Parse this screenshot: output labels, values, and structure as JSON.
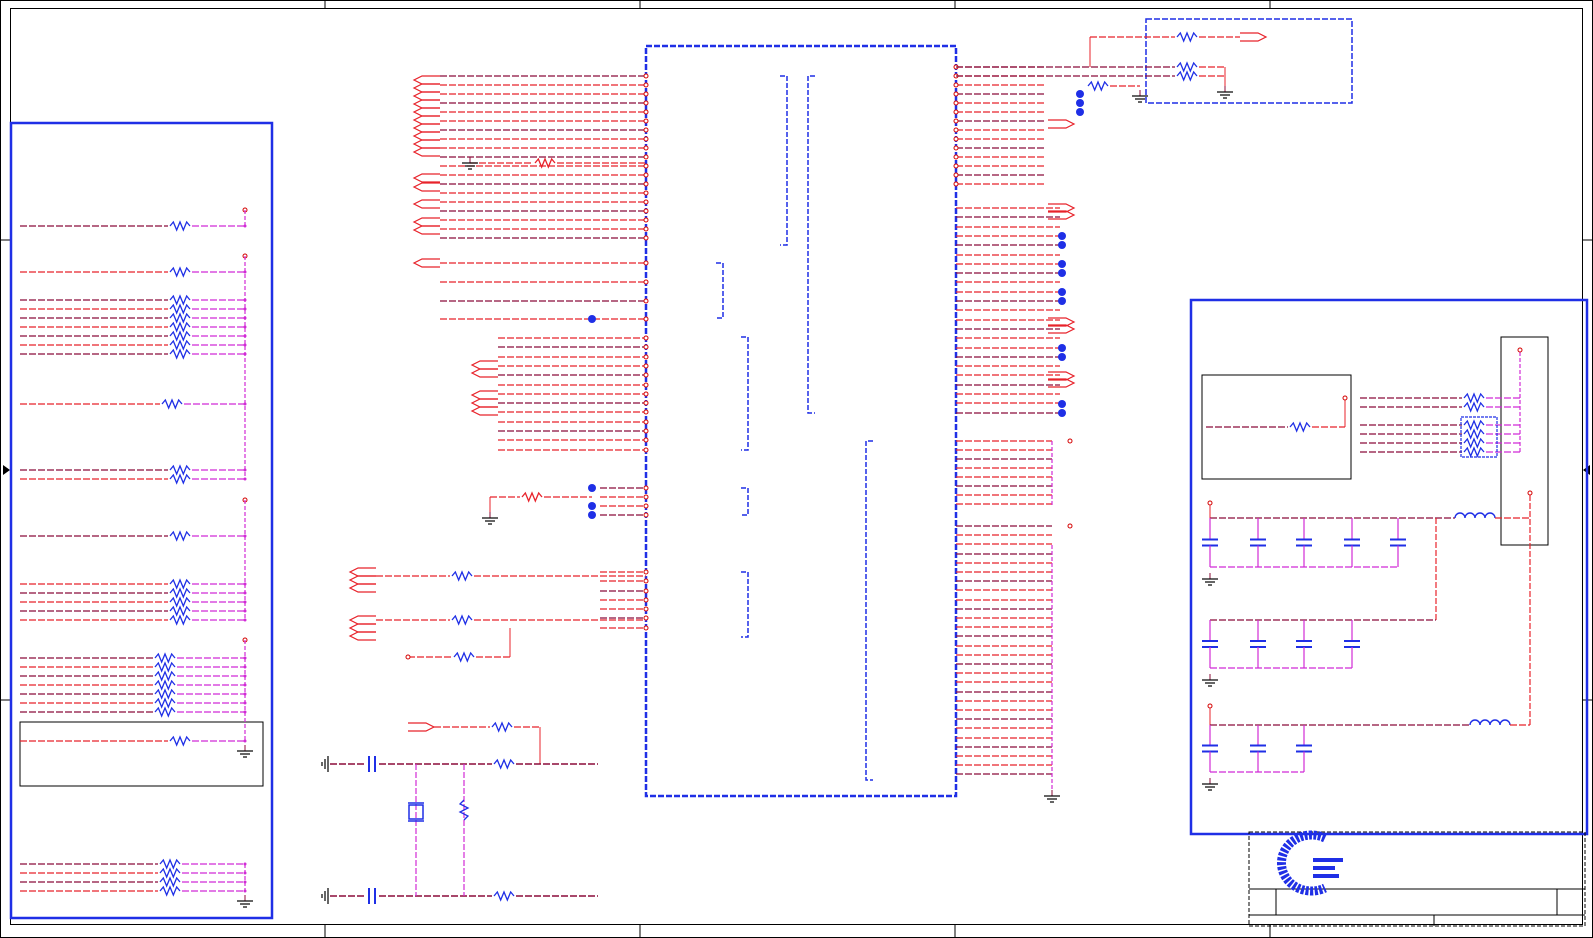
{
  "title_block": {
    "logo_name": "company-logo-icon"
  },
  "colors": {
    "background": "#ffffff",
    "border": "#000000",
    "box_blue": "#1f2fe6",
    "net_red": "#e8232b",
    "net_dark": "#8b0c3a",
    "wire_magenta": "#d12bd6",
    "resistor_blue": "#1f2fe6",
    "pin_red": "#d40000",
    "logo_blue": "#1f2fe6"
  }
}
